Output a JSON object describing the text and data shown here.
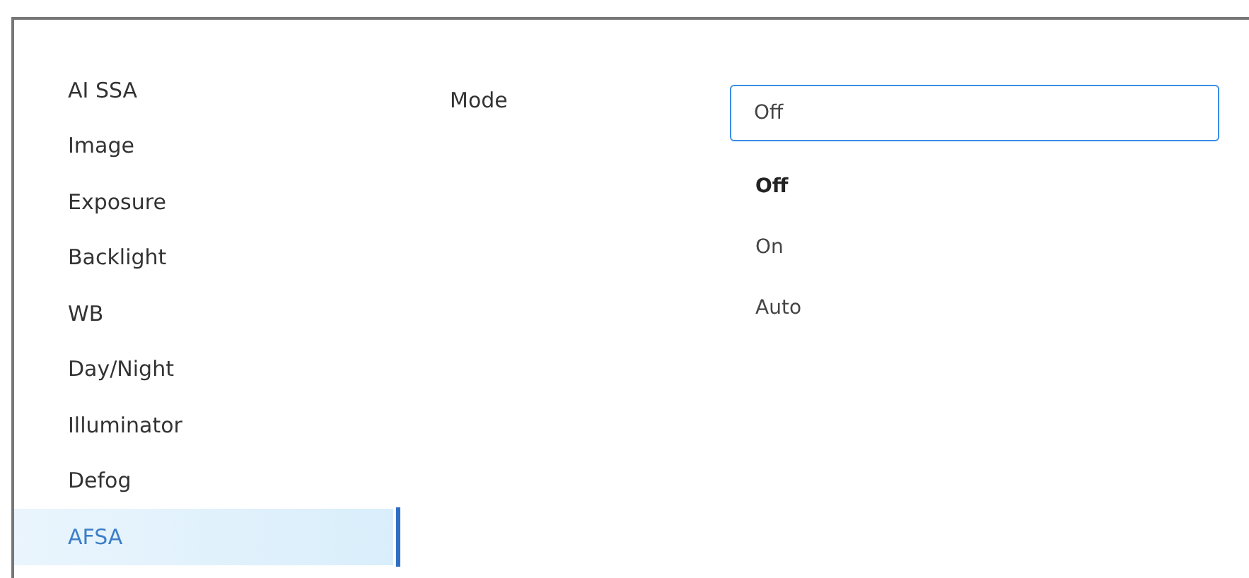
{
  "sidebar": {
    "items": [
      {
        "label": "AI SSA",
        "selected": false
      },
      {
        "label": "Image",
        "selected": false
      },
      {
        "label": "Exposure",
        "selected": false
      },
      {
        "label": "Backlight",
        "selected": false
      },
      {
        "label": "WB",
        "selected": false
      },
      {
        "label": "Day/Night",
        "selected": false
      },
      {
        "label": "Illuminator",
        "selected": false
      },
      {
        "label": "Defog",
        "selected": false
      },
      {
        "label": "AFSA",
        "selected": true
      }
    ]
  },
  "field": {
    "label": "Mode",
    "value": "Off",
    "expanded": true,
    "options": [
      {
        "label": "Off",
        "selected": true
      },
      {
        "label": "On",
        "selected": false
      },
      {
        "label": "Auto",
        "selected": false
      }
    ]
  }
}
